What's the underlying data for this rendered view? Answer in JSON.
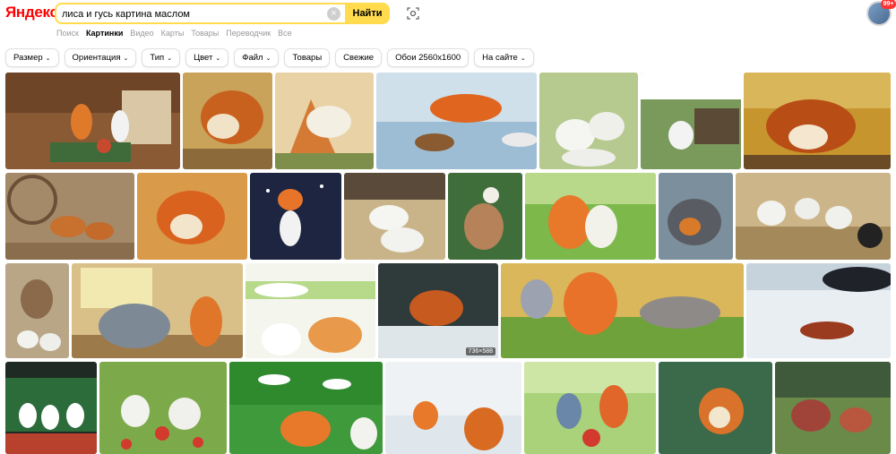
{
  "header": {
    "logo": "Яндекс",
    "search_value": "лиса и гусь картина маслом",
    "search_button": "Найти",
    "notifications_badge": "99+"
  },
  "tabs": [
    {
      "label": "Поиск"
    },
    {
      "label": "Картинки",
      "active": true
    },
    {
      "label": "Видео"
    },
    {
      "label": "Карты"
    },
    {
      "label": "Товары"
    },
    {
      "label": "Переводчик"
    },
    {
      "label": "Все"
    }
  ],
  "filters": [
    {
      "label": "Размер",
      "dropdown": true
    },
    {
      "label": "Ориентация",
      "dropdown": true
    },
    {
      "label": "Тип",
      "dropdown": true
    },
    {
      "label": "Цвет",
      "dropdown": true
    },
    {
      "label": "Файл",
      "dropdown": true
    },
    {
      "label": "Товары",
      "dropdown": false
    },
    {
      "label": "Свежие",
      "dropdown": false
    },
    {
      "label": "Обои 2560x1600",
      "dropdown": false
    },
    {
      "label": "На сайте",
      "dropdown": true
    }
  ],
  "results": {
    "size_label": "736×588"
  },
  "colors": {
    "logo": "#ff0000",
    "search_accent": "#ffdb4d",
    "badge": "#ff3333"
  }
}
